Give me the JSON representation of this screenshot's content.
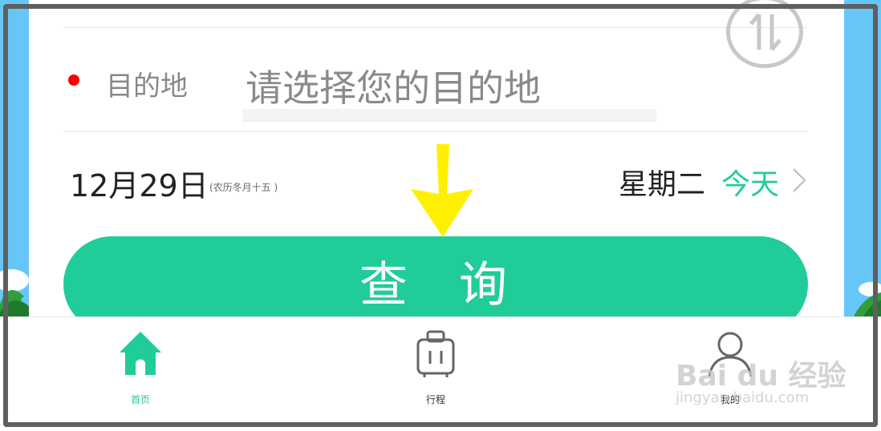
{
  "colors": {
    "accent": "#20cc9a",
    "required_dot": "#ff0000",
    "arrow": "#ffef00",
    "sky": "#66c6f7",
    "frame": "#5f5f5f"
  },
  "form": {
    "destination_label": "目的地",
    "destination_placeholder": "请选择您的目的地",
    "swap_icon": "swap-vertical-icon"
  },
  "date": {
    "main": "12月29日",
    "lunar": "(农历冬月十五 )",
    "weekday": "星期二",
    "relative": "今天"
  },
  "query_button": {
    "label": "查询"
  },
  "tabs": [
    {
      "label": "首页",
      "icon": "home-icon",
      "active": true
    },
    {
      "label": "行程",
      "icon": "luggage-icon",
      "active": false
    },
    {
      "label": "我的",
      "icon": "user-icon",
      "active": false
    }
  ],
  "watermark": {
    "brand": "Bai du 经验",
    "url": "jingyan.baidu.com"
  }
}
